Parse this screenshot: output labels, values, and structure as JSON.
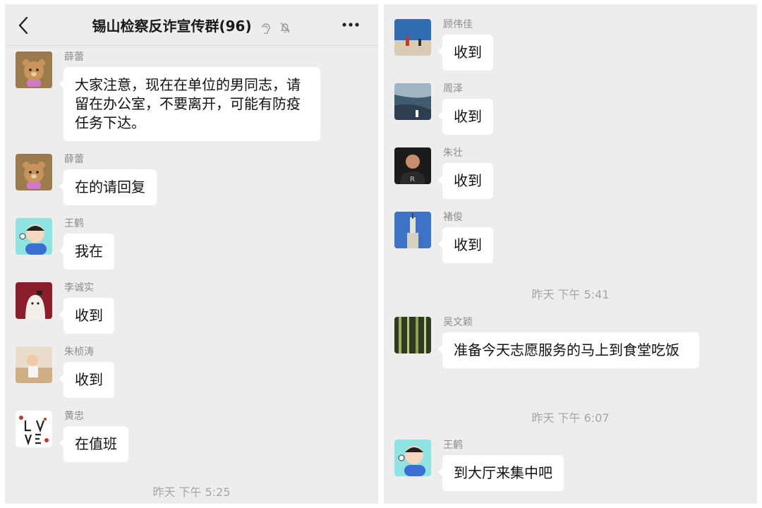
{
  "left": {
    "header": {
      "title": "锡山检察反诈宣传群(96)"
    },
    "messages": [
      {
        "sender": "薛蕾",
        "text": "大家注意，现在在单位的男同志，请留在办公室，不要离开，可能有防疫任务下达。",
        "avatar": "bear-avatar"
      },
      {
        "sender": "薛蕾",
        "text": "在的请回复",
        "avatar": "bear-avatar"
      },
      {
        "sender": "王鹤",
        "text": "我在",
        "avatar": "cartoon-man-avatar"
      },
      {
        "sender": "李诚实",
        "text": "收到",
        "avatar": "cartoon-bird-avatar"
      },
      {
        "sender": "朱桢涛",
        "text": "收到",
        "avatar": "child-photo-avatar"
      },
      {
        "sender": "黄忠",
        "text": "在值班",
        "avatar": "love-text-avatar"
      }
    ],
    "time_bottom": "昨天 下午 5:25"
  },
  "right": {
    "messages": [
      {
        "sender": "顾伟佳",
        "text": "收到",
        "avatar": "beach-photo-avatar"
      },
      {
        "sender": "周泽",
        "text": "收到",
        "avatar": "coast-photo-avatar"
      },
      {
        "sender": "朱壮",
        "text": "收到",
        "avatar": "portrait-photo-avatar"
      },
      {
        "sender": "褚俊",
        "text": "收到",
        "avatar": "tower-photo-avatar"
      }
    ],
    "time1": "昨天 下午 5:41",
    "msg_wu": {
      "sender": "吴文颖",
      "text": "准备今天志愿服务的马上到食堂吃饭",
      "avatar": "bamboo-photo-avatar"
    },
    "time2": "昨天 下午 6:07",
    "msg_wang": {
      "sender": "王鹤",
      "text": "到大厅来集中吧",
      "avatar": "cartoon-man-avatar"
    }
  },
  "colors": {
    "background": "#ededed",
    "bubble": "#ffffff",
    "sender": "#8c8c8c",
    "time": "#a5a5a5"
  }
}
